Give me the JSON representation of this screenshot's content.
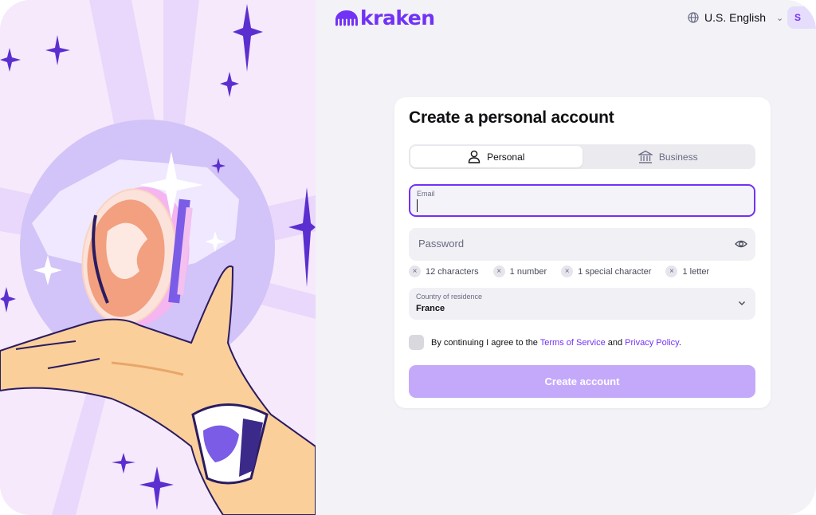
{
  "brand": {
    "name": "kraken",
    "color": "#7132f5"
  },
  "header": {
    "language_icon": "globe-icon",
    "language": "U.S. English",
    "language_chevron": "⌄",
    "signin_stub": "S"
  },
  "form": {
    "title": "Create a personal account",
    "account_types": [
      {
        "label": "Personal",
        "icon": "person-icon",
        "selected": true
      },
      {
        "label": "Business",
        "icon": "bank-icon",
        "selected": false
      }
    ],
    "email": {
      "label": "Email",
      "value": ""
    },
    "password": {
      "placeholder": "Password",
      "value": ""
    },
    "requirements": [
      "12 characters",
      "1 number",
      "1 special character",
      "1 letter"
    ],
    "requirement_icon": "×",
    "country": {
      "label": "Country of residence",
      "value": "France"
    },
    "agreement": {
      "prefix": "By continuing I agree to the ",
      "terms": "Terms of Service",
      "middle": " and ",
      "privacy": "Privacy Policy",
      "suffix": "."
    },
    "submit_label": "Create account"
  },
  "colors": {
    "accent": "#7132f5",
    "submit_disabled": "#c4a9fb",
    "illustration_bg": "#f6e9fb"
  }
}
